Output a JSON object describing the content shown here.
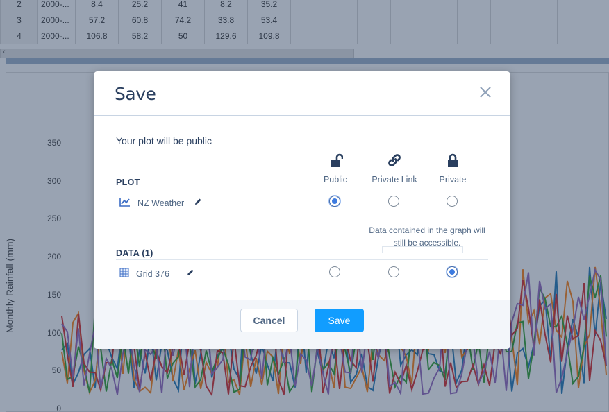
{
  "background": {
    "grid_rows": [
      {
        "row": "2",
        "date": "2000-...",
        "values": [
          "8.4",
          "25.2",
          "41",
          "8.2",
          "35.2"
        ]
      },
      {
        "row": "3",
        "date": "2000-...",
        "values": [
          "57.2",
          "60.8",
          "74.2",
          "33.8",
          "53.4"
        ]
      },
      {
        "row": "4",
        "date": "2000-...",
        "values": [
          "106.8",
          "58.2",
          "50",
          "129.6",
          "109.8"
        ]
      }
    ],
    "chart": {
      "ylabel": "Monthly Rainfall (mm)",
      "yticks": [
        "350",
        "300",
        "250",
        "200",
        "150",
        "100",
        "50",
        "0"
      ]
    }
  },
  "dialog": {
    "title": "Save",
    "notice": "Your plot will be public",
    "columns": [
      {
        "label": "Public",
        "icon": "unlock-icon"
      },
      {
        "label": "Private Link",
        "icon": "link-icon"
      },
      {
        "label": "Private",
        "icon": "lock-icon"
      }
    ],
    "plot_section": {
      "label": "PLOT",
      "item_name": "NZ Weather",
      "item_icon": "line-chart-icon",
      "selected": "Public"
    },
    "data_section": {
      "label": "DATA (1)",
      "item_name": "Grid 376",
      "item_icon": "grid-icon",
      "selected": "Private"
    },
    "data_note": "Data contained in the graph will still be accessible.",
    "cancel_label": "Cancel",
    "save_label": "Save"
  },
  "colors": {
    "primary": "#119dff",
    "text_dark": "#2a3f5f",
    "text_muted": "#506784",
    "icon_dark": "#2a3f5f",
    "overlay": "#2a3f5f"
  }
}
